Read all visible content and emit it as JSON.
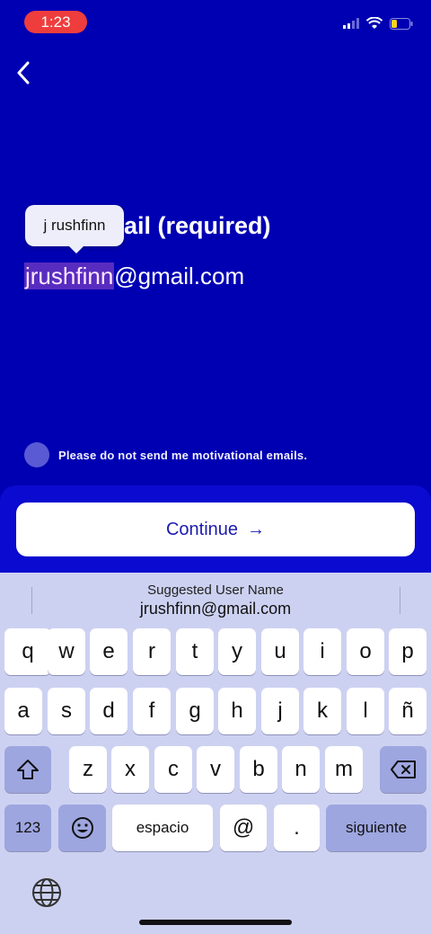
{
  "status": {
    "time": "1:23"
  },
  "screen": {
    "title": "ail (required)",
    "email_selected": "jrushfinn",
    "email_rest": "@gmail.com",
    "tooltip": "j rushfinn",
    "opt_out_label": "Please do not send me motivational emails.",
    "continue_label": "Continue",
    "continue_arrow": "→"
  },
  "keyboard": {
    "suggest_title": "Suggested User Name",
    "suggest_value": "jrushfinn@gmail.com",
    "row1": [
      "q",
      "w",
      "e",
      "r",
      "t",
      "y",
      "u",
      "i",
      "o",
      "p"
    ],
    "row2": [
      "a",
      "s",
      "d",
      "f",
      "g",
      "h",
      "j",
      "k",
      "l",
      "ñ"
    ],
    "row3": [
      "z",
      "x",
      "c",
      "v",
      "b",
      "n",
      "m"
    ],
    "numbers_label": "123",
    "space_label": "espacio",
    "at_label": "@",
    "dot_label": ".",
    "return_label": "siguiente"
  },
  "colors": {
    "background": "#0000b3",
    "accent": "#1b1bb0",
    "status_pill": "#ef3d3d"
  }
}
